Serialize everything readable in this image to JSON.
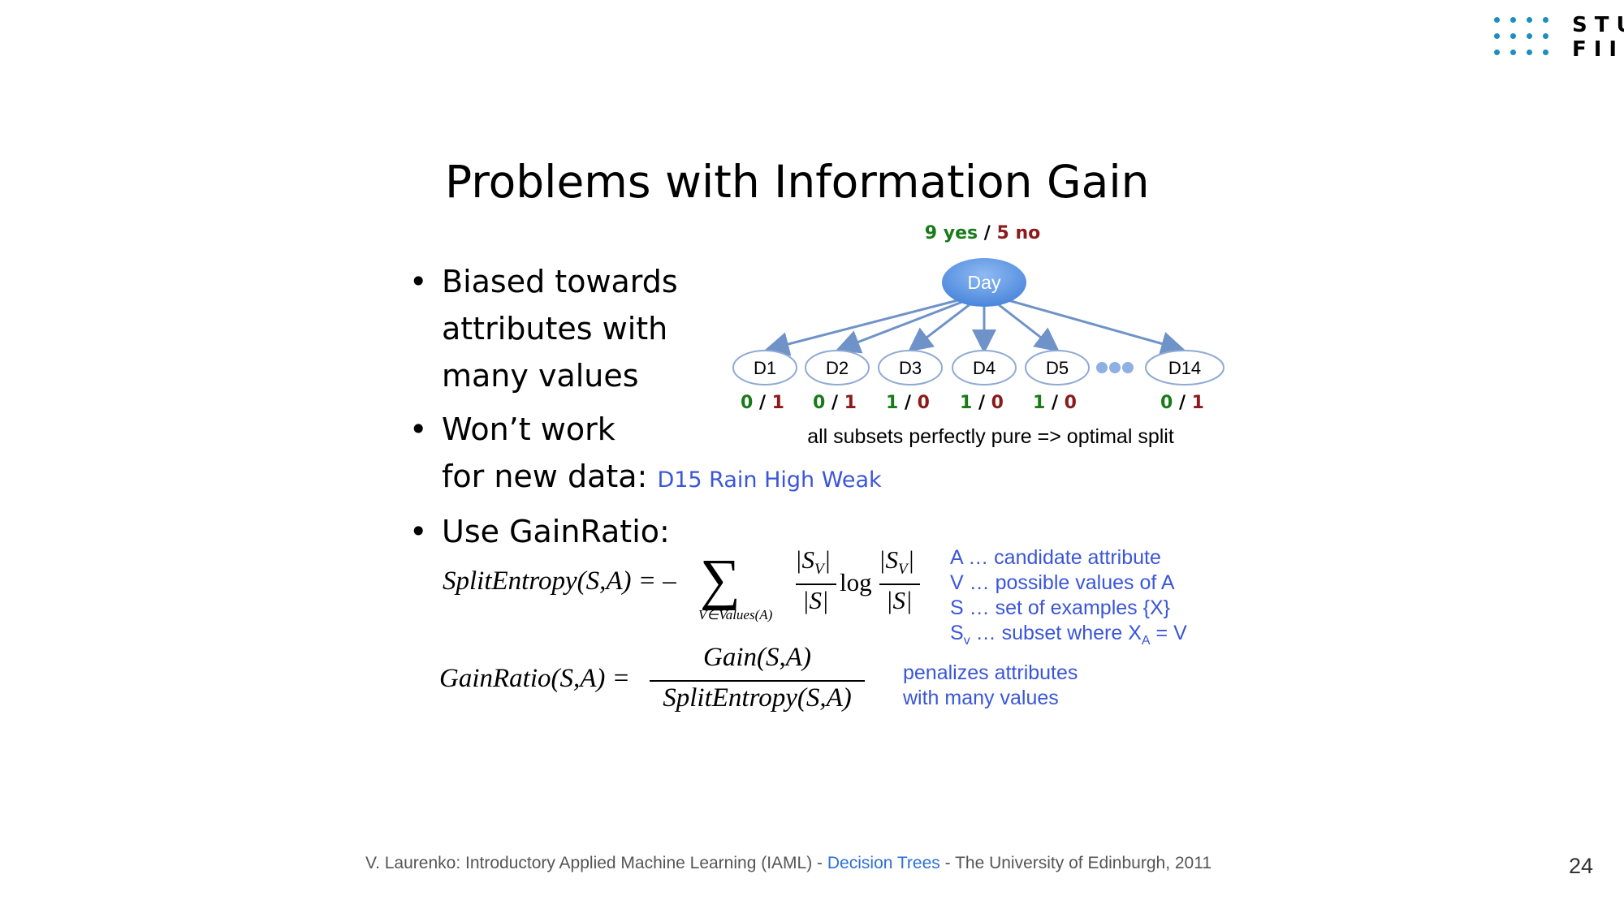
{
  "logo": {
    "line1": "STU",
    "line2": "FIIT"
  },
  "title": "Problems with Information Gain",
  "bullets": {
    "b1_line1": "Biased towards",
    "b1_line2": "attributes with",
    "b1_line3": "many values",
    "b2_line1": "Won’t work",
    "b2_line2": "for new data:",
    "b2_example": "D15 Rain High Weak",
    "b3": "Use GainRatio:",
    "marker": "•"
  },
  "tree": {
    "root_counts": {
      "yes": "9 yes",
      "sep": "/",
      "no": "5 no"
    },
    "root_label": "Day",
    "nodes": [
      {
        "label": "D1",
        "yes": "0",
        "no": "1"
      },
      {
        "label": "D2",
        "yes": "0",
        "no": "1"
      },
      {
        "label": "D3",
        "yes": "1",
        "no": "0"
      },
      {
        "label": "D4",
        "yes": "1",
        "no": "0"
      },
      {
        "label": "D5",
        "yes": "1",
        "no": "0"
      },
      {
        "label": "D14",
        "yes": "0",
        "no": "1"
      }
    ],
    "caption": "all subsets perfectly pure => optimal split",
    "colors": {
      "yes": "#1a7a1a",
      "no": "#8b1a1a",
      "root": "#4f8fe0",
      "edge": "#6f93c8"
    }
  },
  "formula1": {
    "lhs": "SplitEntropy(S,A) = –",
    "sigma": "∑",
    "sub": "V∈Values(A)",
    "num1": "|S",
    "num1_sub": "V",
    "num1_end": "|",
    "den1": "|S|",
    "log": "log",
    "num2": "|S",
    "num2_sub": "V",
    "num2_end": "|",
    "den2": "|S|"
  },
  "legend": {
    "l1": "A  … candidate attribute",
    "l2": "V  … possible values of A",
    "l3": "S  … set of examples {X}",
    "l4_a": "S",
    "l4_sub": "v",
    "l4_b": " … subset where X",
    "l4_sub2": "A",
    "l4_c": " = V"
  },
  "formula2": {
    "lhs": "GainRatio(S,A) =",
    "num": "Gain(S,A)",
    "den": "SplitEntropy(S,A)"
  },
  "note": {
    "l1": "penalizes attributes",
    "l2": "with many values"
  },
  "footer": {
    "pre": "V. Laurenko: Introductory Applied Machine Learning (IAML) - ",
    "link": "Decision Trees",
    "post": " - The University of Edinburgh, 2011"
  },
  "page_number": "24"
}
